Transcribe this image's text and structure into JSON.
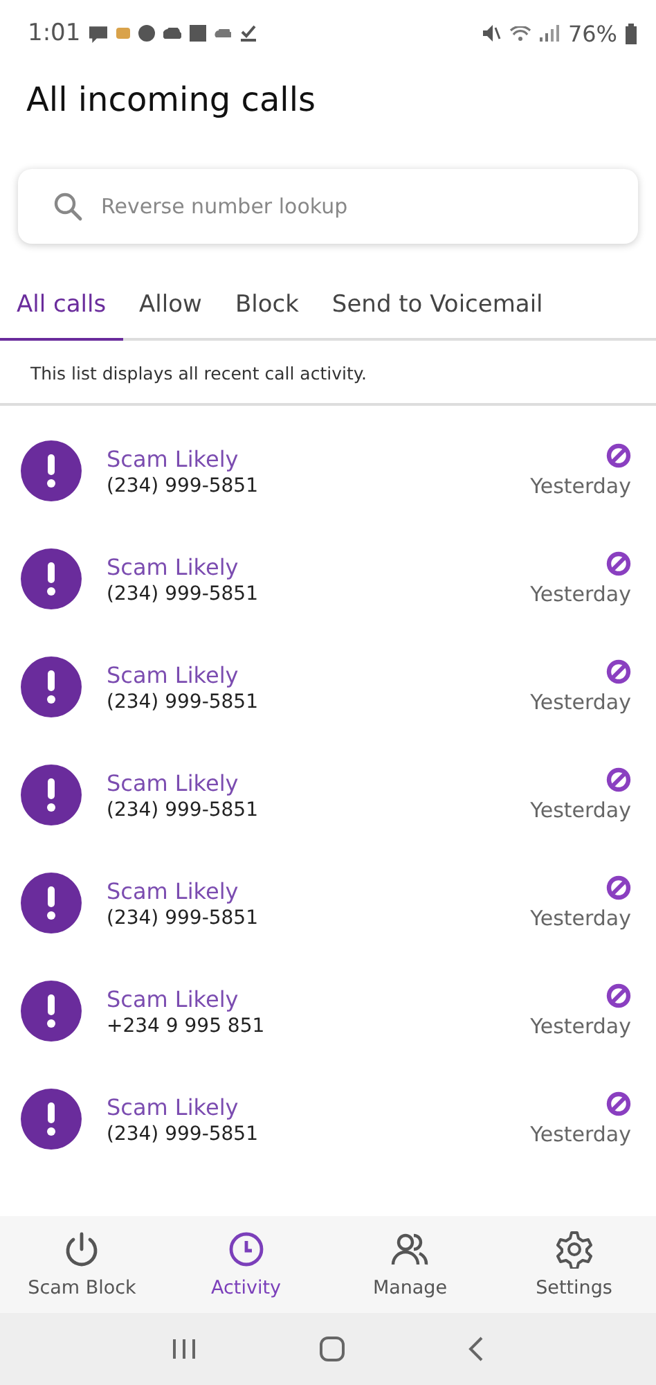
{
  "status_bar": {
    "time": "1:01",
    "battery": "76%"
  },
  "title": "All incoming calls",
  "search": {
    "placeholder": "Reverse number lookup"
  },
  "tabs": [
    {
      "label": "All calls",
      "selected": true
    },
    {
      "label": "Allow",
      "selected": false
    },
    {
      "label": "Block",
      "selected": false
    },
    {
      "label": "Send to Voicemail",
      "selected": false
    }
  ],
  "info": "This list displays all recent call activity.",
  "calls": [
    {
      "name": "Scam Likely",
      "number": "(234) 999-5851",
      "time": "Yesterday"
    },
    {
      "name": "Scam Likely",
      "number": "(234) 999-5851",
      "time": "Yesterday"
    },
    {
      "name": "Scam Likely",
      "number": "(234) 999-5851",
      "time": "Yesterday"
    },
    {
      "name": "Scam Likely",
      "number": "(234) 999-5851",
      "time": "Yesterday"
    },
    {
      "name": "Scam Likely",
      "number": "(234) 999-5851",
      "time": "Yesterday"
    },
    {
      "name": "Scam Likely",
      "number": "+234 9 995 851",
      "time": "Yesterday"
    },
    {
      "name": "Scam Likely",
      "number": "(234) 999-5851",
      "time": "Yesterday"
    }
  ],
  "bottom_nav": [
    {
      "label": "Scam Block",
      "kind": "power",
      "selected": false
    },
    {
      "label": "Activity",
      "kind": "clock",
      "selected": true
    },
    {
      "label": "Manage",
      "kind": "people",
      "selected": false
    },
    {
      "label": "Settings",
      "kind": "gear",
      "selected": false
    }
  ]
}
